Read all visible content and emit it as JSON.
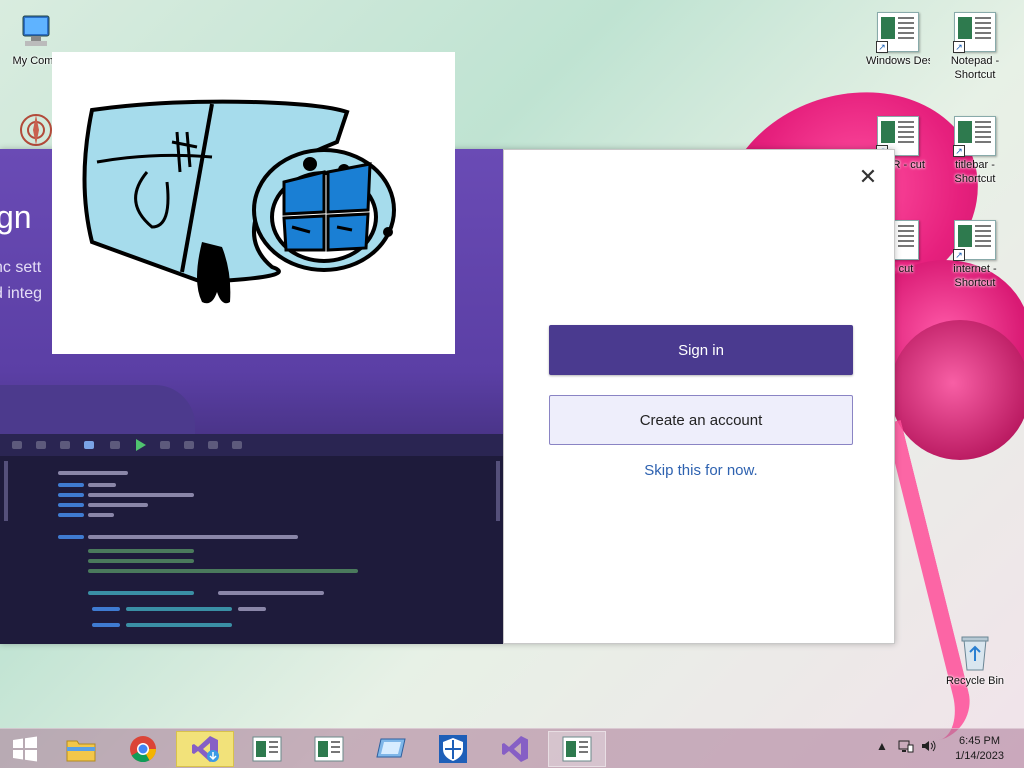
{
  "desktop": {
    "icons": [
      {
        "label": "My Comp",
        "icon": "computer-icon"
      },
      {
        "label": "",
        "icon": "mandala-icon"
      },
      {
        "label": "Windows Destroye...",
        "icon": "shortcut-doc-icon"
      },
      {
        "label": "Notepad - Shortcut",
        "icon": "shortcut-doc-icon"
      },
      {
        "label": "STER - cut",
        "icon": "shortcut-doc-icon"
      },
      {
        "label": "titlebar - Shortcut",
        "icon": "shortcut-doc-icon"
      },
      {
        "label": "n - cut",
        "icon": "shortcut-doc-icon"
      },
      {
        "label": "internet - Shortcut",
        "icon": "shortcut-doc-icon"
      },
      {
        "label": "Recycle Bin",
        "icon": "recycle-bin-icon"
      }
    ]
  },
  "drawing": {
    "description_icon": "windows-logo-drawing"
  },
  "vs_dialog": {
    "promo_title": "gn",
    "promo_line1": "nc sett",
    "promo_line2": "d integ",
    "close_label": "✕",
    "signin_label": "Sign in",
    "create_label": "Create an account",
    "skip_label": "Skip this for now."
  },
  "taskbar": {
    "items": [
      {
        "icon": "start-icon"
      },
      {
        "icon": "file-explorer-icon"
      },
      {
        "icon": "chrome-icon"
      },
      {
        "icon": "visual-studio-installer-icon"
      },
      {
        "icon": "app-window-icon"
      },
      {
        "icon": "app-window-icon"
      },
      {
        "icon": "remote-desktop-icon"
      },
      {
        "icon": "defender-shield-icon"
      },
      {
        "icon": "visual-studio-icon"
      },
      {
        "icon": "app-window-icon"
      }
    ],
    "clock_time": "6:45 PM",
    "clock_date": "1/14/2023"
  }
}
